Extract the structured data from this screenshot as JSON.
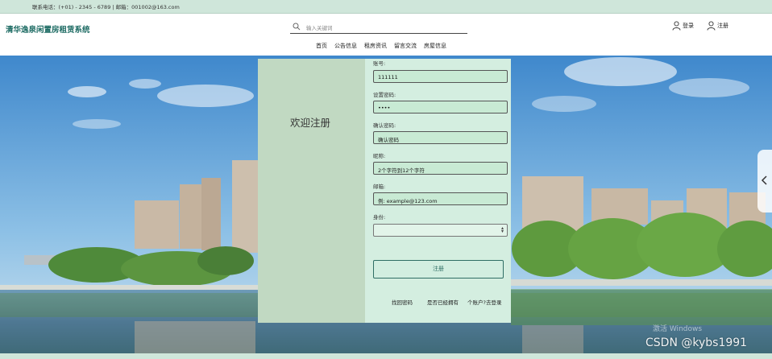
{
  "topbar": {
    "contact": "联系电话：(+01) - 2345 - 6789 | 邮箱：001002@163.com"
  },
  "header": {
    "site_title": "清华逸泉闲置房租赁系统",
    "search_placeholder": "输入关键词",
    "login_label": "登录",
    "register_label": "注册"
  },
  "nav": {
    "items": [
      "首页",
      "公告信息",
      "租房资讯",
      "留言交流",
      "房屋信息"
    ]
  },
  "register_form": {
    "welcome": "欢迎注册",
    "fields": [
      {
        "label": "账号:",
        "value": "111111"
      },
      {
        "label": "设置密码:",
        "value": "••••"
      },
      {
        "label": "确认密码:",
        "placeholder": "确认密码"
      },
      {
        "label": "昵称:",
        "placeholder": "2个字符到12个字符"
      },
      {
        "label": "邮箱:",
        "placeholder": "例: example@123.com"
      },
      {
        "label": "身份:",
        "value": ""
      }
    ],
    "submit_label": "注册",
    "links": [
      "找回密码",
      "是否已经拥有",
      "个账户?去登录"
    ]
  },
  "overlay": {
    "windows_watermark": "激活 Windows",
    "csdn_watermark": "CSDN @kybs1991"
  },
  "colors": {
    "accent": "#1d6b63",
    "topbar": "#cfe6da",
    "form_left": "#c1d9c2",
    "form_right": "#d4eee0"
  },
  "icons": [
    "search-icon",
    "user-icon",
    "chevron-left-icon"
  ]
}
